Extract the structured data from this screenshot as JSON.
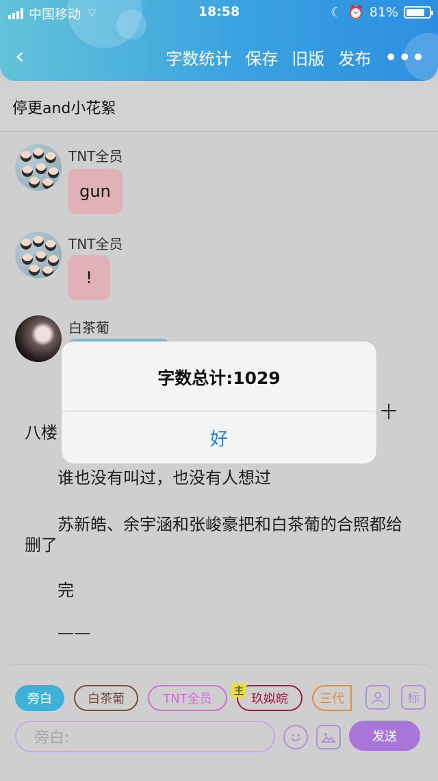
{
  "status": {
    "carrier": "中国移动",
    "time": "18:58",
    "battery": "81%",
    "battery_fraction": 0.81
  },
  "nav": {
    "back": "‹",
    "actions": [
      "字数统计",
      "保存",
      "旧版",
      "发布"
    ],
    "more": "•••"
  },
  "title": "停更and小花絮",
  "messages": [
    {
      "sender": "TNT全员",
      "text": "gun"
    },
    {
      "sender": "TNT全员",
      "text": "!"
    },
    {
      "sender": "白茶葡"
    }
  ],
  "narration": {
    "partial_left": "八楼",
    "partial_right": "十",
    "p1": "谁也没有叫过，也没有人想过",
    "p2": "苏新皓、余宇涵和张峻豪把和白茶葡的合照都给删了",
    "p3": "完",
    "p4": "——"
  },
  "roles": [
    {
      "label": "旁白",
      "color": "#3fb0d8",
      "active": true
    },
    {
      "label": "白茶葡",
      "color": "#7a4a3a"
    },
    {
      "label": "TNT全员",
      "color": "#d36bd8"
    },
    {
      "label": "玖姒皖",
      "color": "#a0173f",
      "badge": "主"
    },
    {
      "label": "三代",
      "color": "#e98a3d"
    }
  ],
  "tools": {
    "mark": "标"
  },
  "input": {
    "placeholder": "旁白:"
  },
  "send": "发送",
  "alert": {
    "message": "字数总计:1029",
    "ok": "好"
  }
}
